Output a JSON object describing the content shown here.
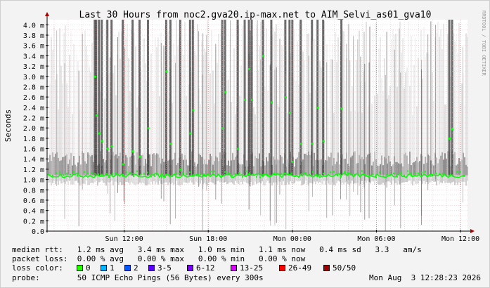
{
  "chart_data": {
    "type": "line",
    "title": "Last 30 Hours from noc2.gva20.ip-max.net to AIM_Selvi_as01_gva10",
    "ylabel": "Seconds",
    "watermark": "RRDTOOL / TOBI OETIKER",
    "ylim": [
      0,
      4.1
    ],
    "y_ticks": [
      "0.0",
      "0.2 m",
      "0.4 m",
      "0.6 m",
      "0.8 m",
      "1.0 m",
      "1.2 m",
      "1.4 m",
      "1.6 m",
      "1.8 m",
      "2.0 m",
      "2.2 m",
      "2.4 m",
      "2.6 m",
      "2.8 m",
      "3.0 m",
      "3.2 m",
      "3.4 m",
      "3.6 m",
      "3.8 m",
      "4.0 m"
    ],
    "y_tick_values": [
      0,
      0.2,
      0.4,
      0.6,
      0.8,
      1.0,
      1.2,
      1.4,
      1.6,
      1.8,
      2.0,
      2.2,
      2.4,
      2.6,
      2.8,
      3.0,
      3.2,
      3.4,
      3.6,
      3.8,
      4.0
    ],
    "x_range_hours": [
      -30,
      0
    ],
    "x_ticks": [
      {
        "label": "Sun 12:00",
        "hours": -24.5
      },
      {
        "label": "Sun 18:00",
        "hours": -18.5
      },
      {
        "label": "Mon 00:00",
        "hours": -12.5
      },
      {
        "label": "Mon 06:00",
        "hours": -6.5
      },
      {
        "label": "Mon 12:00",
        "hours": -0.5
      }
    ],
    "grid": true,
    "series": [
      {
        "name": "median rtt",
        "color": "#00ff00",
        "baseline_ms": 1.08,
        "spikes": [
          {
            "hours": -26.6,
            "ms": 3.0
          },
          {
            "hours": -26.5,
            "ms": 2.25
          },
          {
            "hours": -26.3,
            "ms": 1.9
          },
          {
            "hours": -26.1,
            "ms": 1.75
          },
          {
            "hours": -25.7,
            "ms": 1.6
          },
          {
            "hours": -25.4,
            "ms": 1.65
          },
          {
            "hours": -24.6,
            "ms": 1.3
          },
          {
            "hours": -23.9,
            "ms": 1.55
          },
          {
            "hours": -23.4,
            "ms": 1.45
          },
          {
            "hours": -22.8,
            "ms": 2.0
          },
          {
            "hours": -21.5,
            "ms": 3.1
          },
          {
            "hours": -21.2,
            "ms": 1.7
          },
          {
            "hours": -20.5,
            "ms": 1.2
          },
          {
            "hours": -19.8,
            "ms": 1.9
          },
          {
            "hours": -19.6,
            "ms": 2.35
          },
          {
            "hours": -17.5,
            "ms": 2.0
          },
          {
            "hours": -17.3,
            "ms": 2.7
          },
          {
            "hours": -16.4,
            "ms": 1.6
          },
          {
            "hours": -15.9,
            "ms": 2.55
          },
          {
            "hours": -15.6,
            "ms": 3.15
          },
          {
            "hours": -15.4,
            "ms": 2.55
          },
          {
            "hours": -14.6,
            "ms": 3.4
          },
          {
            "hours": -14.0,
            "ms": 2.5
          },
          {
            "hours": -13.0,
            "ms": 2.6
          },
          {
            "hours": -12.7,
            "ms": 2.3
          },
          {
            "hours": -12.5,
            "ms": 1.35
          },
          {
            "hours": -11.9,
            "ms": 1.7
          },
          {
            "hours": -11.1,
            "ms": 1.7
          },
          {
            "hours": -10.7,
            "ms": 2.4
          },
          {
            "hours": -10.3,
            "ms": 1.75
          },
          {
            "hours": -9.0,
            "ms": 2.38
          },
          {
            "hours": -1.3,
            "ms": 1.8
          },
          {
            "hours": -1.1,
            "ms": 1.98
          }
        ]
      }
    ]
  },
  "stats": {
    "median_rtt": "median rtt:   1.2 ms avg   3.4 ms max   1.0 ms min   1.1 ms now   0.4 ms sd   3.3   am/s",
    "packet_loss": "packet loss:  0.00 % avg   0.00 % max   0.00 % min   0.00 % now",
    "probe": "probe:        50 ICMP Echo Pings (56 Bytes) every 300s",
    "timestamp": "Mon Aug  3 12:28:23 2026"
  },
  "loss_legend": {
    "label": "loss color:",
    "items": [
      {
        "label": "0",
        "color": "#26ff00"
      },
      {
        "label": "1",
        "color": "#00b8ff"
      },
      {
        "label": "2",
        "color": "#0059ff"
      },
      {
        "label": "3-5",
        "color": "#5e00ff"
      },
      {
        "label": "6-12",
        "color": "#7e00ff"
      },
      {
        "label": "13-25",
        "color": "#dd00ff"
      },
      {
        "label": "26-49",
        "color": "#ff0000"
      },
      {
        "label": "50/50",
        "color": "#a10000"
      }
    ]
  }
}
